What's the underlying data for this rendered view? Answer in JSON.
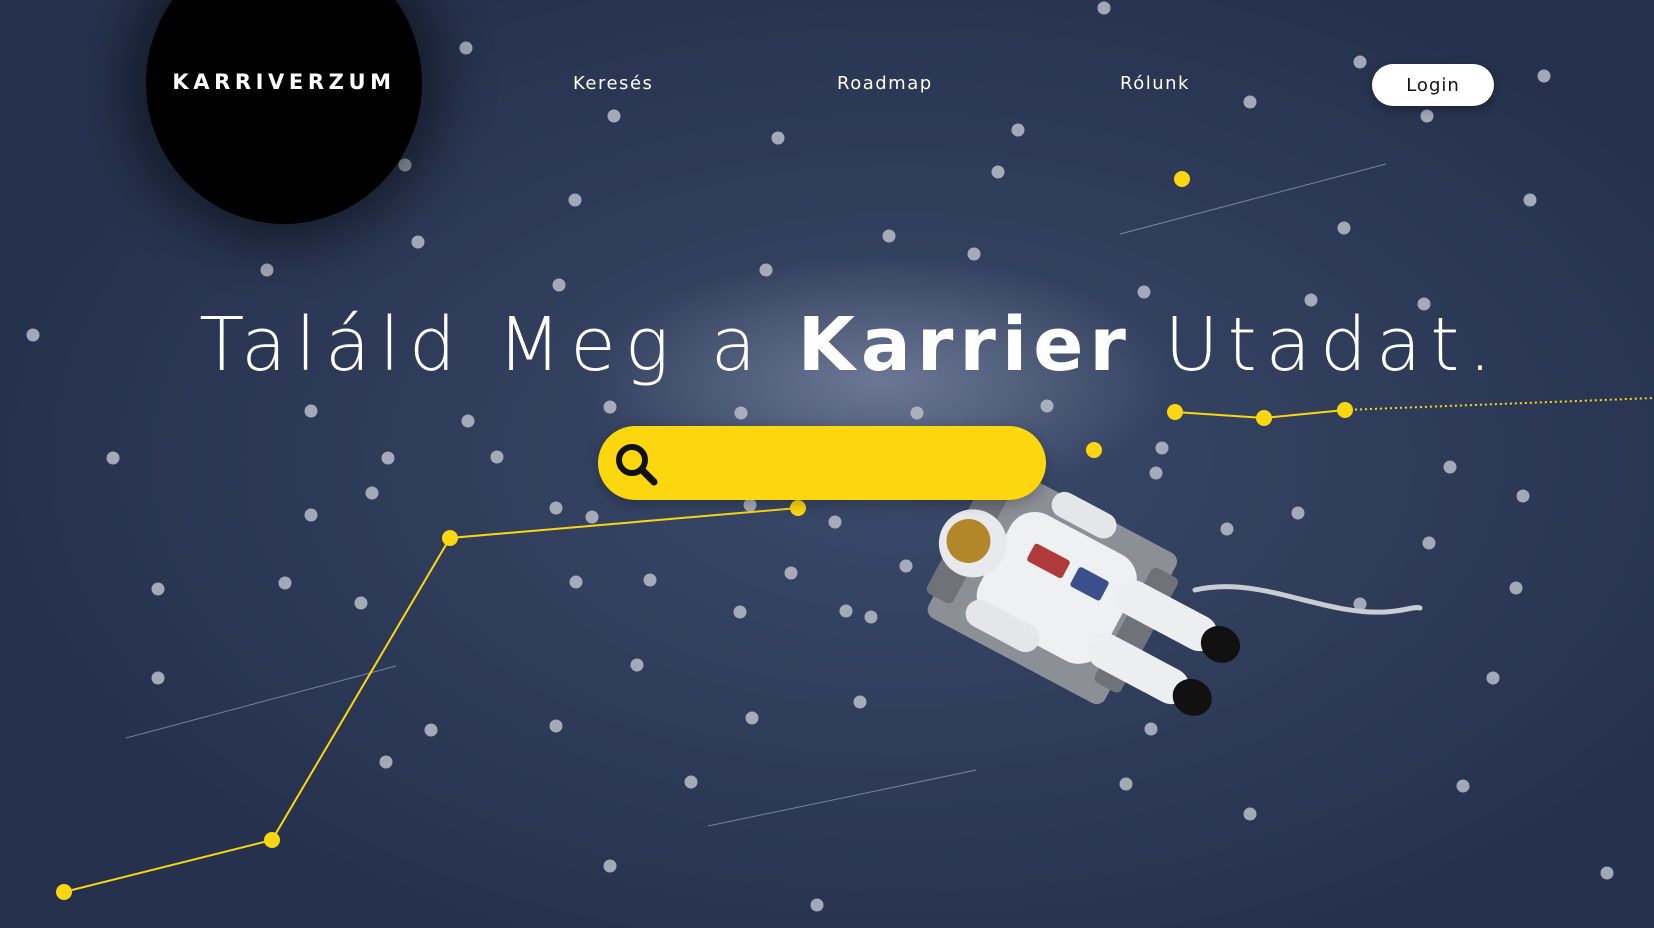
{
  "brand": {
    "name": "KARRIVERZUM"
  },
  "nav": {
    "items": [
      {
        "label": "Keresés"
      },
      {
        "label": "Roadmap"
      },
      {
        "label": "Rólunk"
      }
    ],
    "login_label": "Login"
  },
  "hero": {
    "prefix": "Találd Meg a",
    "highlight": "Karrier",
    "suffix": "Utadat."
  },
  "search": {
    "value": "",
    "placeholder": ""
  },
  "icons": {
    "search": "search-icon",
    "astronaut": "astronaut-illustration"
  },
  "colors": {
    "accent": "#fcd60f",
    "background": "#2f3c5a",
    "star": "#b8bdc8",
    "text": "#ffffff"
  }
}
